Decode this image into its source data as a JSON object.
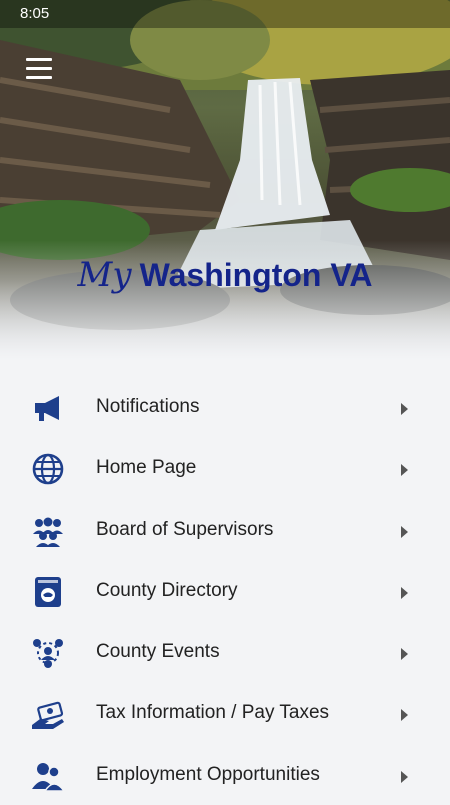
{
  "status_bar": {
    "time": "8:05"
  },
  "header": {
    "menu_icon": "hamburger-menu-icon",
    "brand_prefix": "My",
    "brand_name": "Washington VA"
  },
  "colors": {
    "brand_blue": "#14248a",
    "icon_blue": "#1e3f8c",
    "background": "#f3f4f6"
  },
  "menu": {
    "items": [
      {
        "label": "Notifications",
        "icon": "megaphone-icon"
      },
      {
        "label": "Home Page",
        "icon": "globe-icon"
      },
      {
        "label": "Board of Supervisors",
        "icon": "group-icon"
      },
      {
        "label": "County Directory",
        "icon": "phone-book-icon"
      },
      {
        "label": "County Events",
        "icon": "people-network-icon"
      },
      {
        "label": "Tax Information / Pay Taxes",
        "icon": "money-hand-icon"
      },
      {
        "label": "Employment Opportunities",
        "icon": "employees-icon"
      }
    ]
  }
}
